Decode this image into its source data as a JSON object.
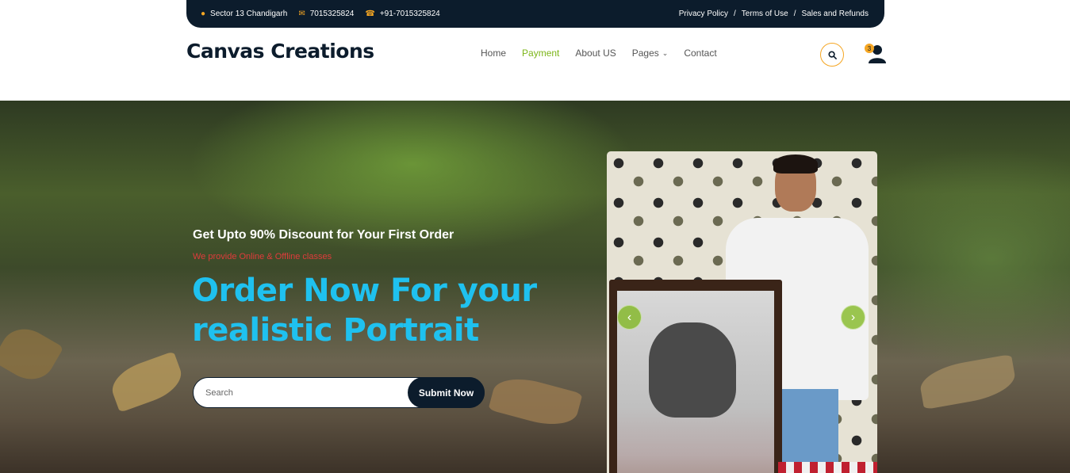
{
  "topbar": {
    "address": "Sector 13 Chandigarh",
    "email": "7015325824",
    "phone": "+91-7015325824",
    "links": [
      "Privacy Policy",
      "Terms of Use",
      "Sales and Refunds"
    ],
    "separator": "/"
  },
  "header": {
    "logo": "Canvas Creations",
    "nav": [
      "Home",
      "Payment",
      "About US",
      "Pages",
      "Contact"
    ],
    "active_nav": "Payment",
    "cart_count": "3"
  },
  "hero": {
    "subtitle": "Get Upto 90% Discount for Your First Order",
    "tagline": "We provide Online & Offline classes",
    "title": "Order Now For your realistic Portrait",
    "search_placeholder": "Search",
    "submit_label": "Submit Now"
  },
  "colors": {
    "dark": "#0c1c2c",
    "accent": "#f5a623",
    "green": "#7cb518",
    "title": "#1fc1ef",
    "tagline": "#e03b3b"
  },
  "icons": [
    "map-marker-icon",
    "envelope-icon",
    "phone-icon",
    "search-icon",
    "user-icon",
    "chevron-down-icon",
    "chevron-left-icon",
    "chevron-right-icon"
  ]
}
